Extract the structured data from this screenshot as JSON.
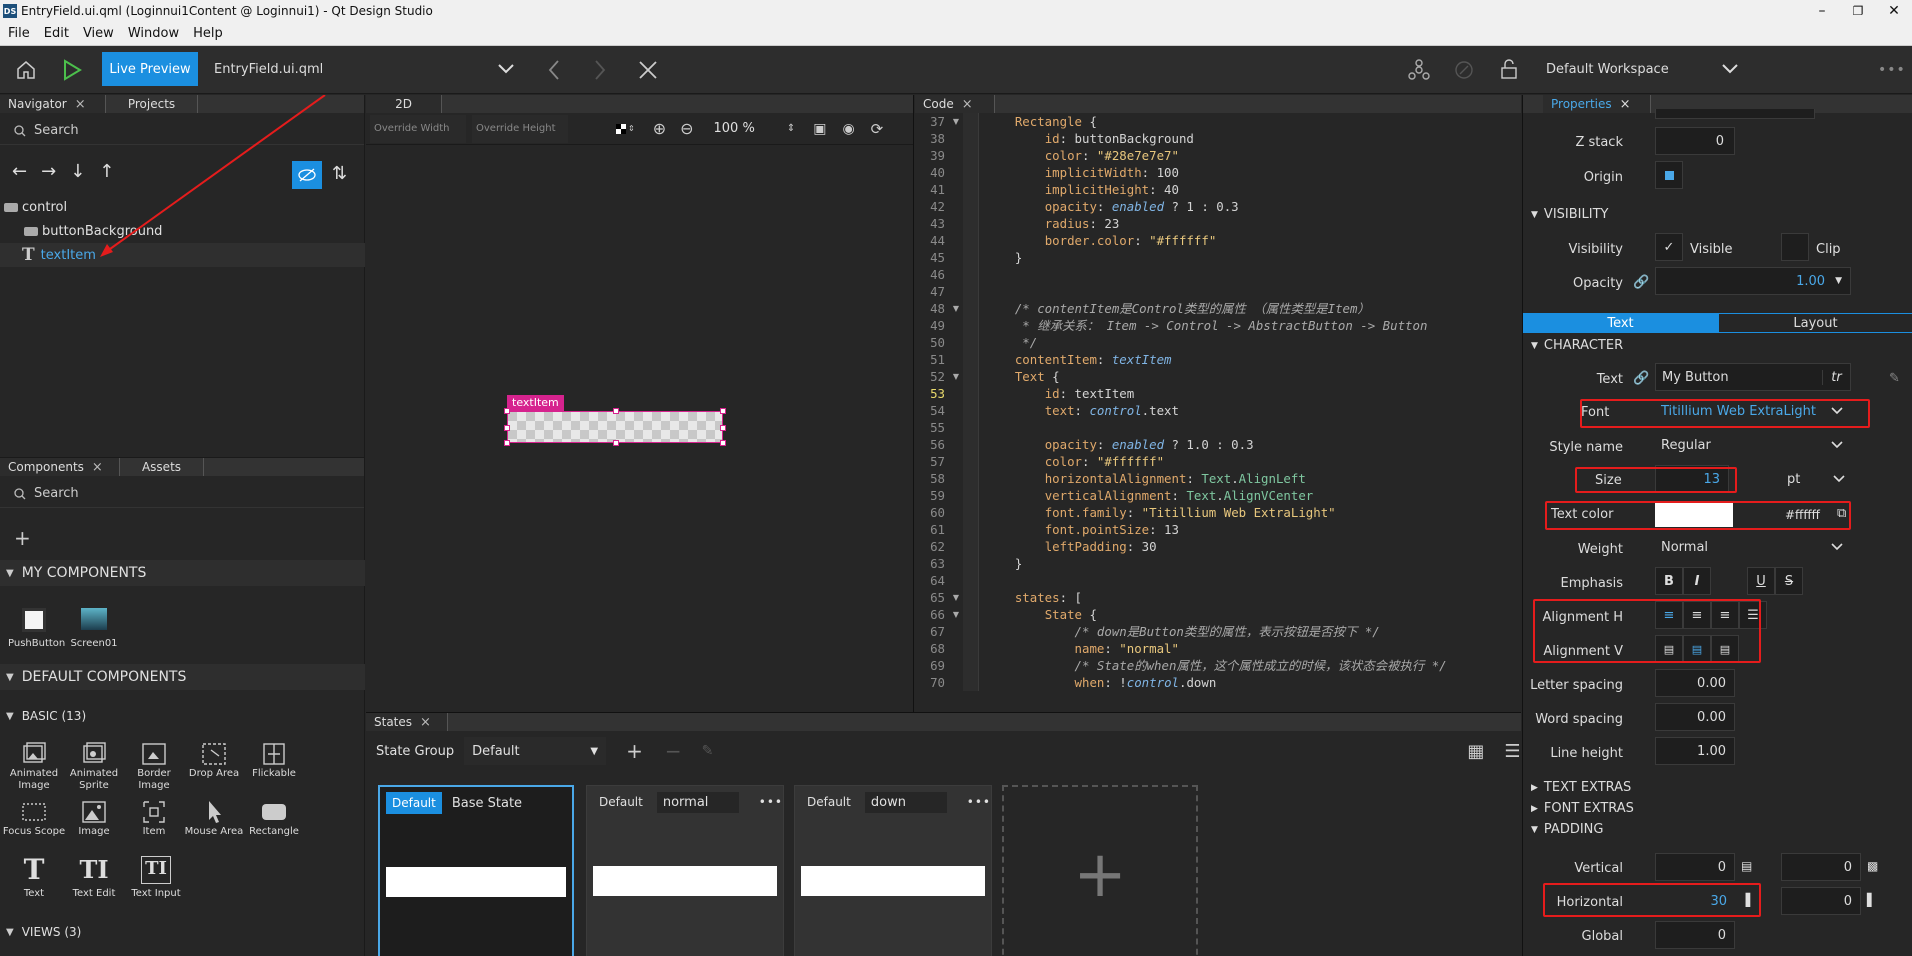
{
  "window": {
    "title": "EntryField.ui.qml (Loginnui1Content @ Loginnui1) - Qt Design Studio",
    "logo": "DS"
  },
  "menu": [
    "File",
    "Edit",
    "View",
    "Window",
    "Help"
  ],
  "toolbar": {
    "live_preview": "Live Preview",
    "file": "EntryField.ui.qml",
    "workspace": "Default Workspace"
  },
  "navigator": {
    "tabs": [
      "Navigator",
      "Projects"
    ],
    "search_placeholder": "Search",
    "tree": [
      {
        "label": "control",
        "icon": "rect-icon"
      },
      {
        "label": "buttonBackground",
        "icon": "rect-icon"
      },
      {
        "label": "textItem",
        "icon": "text-icon"
      }
    ]
  },
  "components": {
    "tabs": [
      "Components",
      "Assets"
    ],
    "search_placeholder": "Search",
    "my_header": "MY COMPONENTS",
    "my_items": [
      "PushButton",
      "Screen01"
    ],
    "default_header": "DEFAULT COMPONENTS",
    "basic_header": "BASIC (13)",
    "basic_items": [
      [
        "Animated",
        "Image"
      ],
      [
        "Animated",
        "Sprite"
      ],
      [
        "Border",
        "Image"
      ],
      [
        "Drop Area"
      ],
      [
        "Flickable"
      ],
      [
        "Focus Scope"
      ],
      [
        "Image"
      ],
      [
        "Item"
      ],
      [
        "Mouse Area"
      ],
      [
        "Rectangle"
      ],
      [
        "Text"
      ],
      [
        "Text Edit"
      ],
      [
        "Text Input"
      ]
    ],
    "views_header": "VIEWS (3)"
  },
  "canvas": {
    "tab": "2D",
    "override_width": "Override Width",
    "override_height": "Override Height",
    "zoom": "100 %",
    "selection_label": "textItem"
  },
  "code": {
    "tab": "Code",
    "lines": [
      {
        "n": "37",
        "t": "    Rectangle {"
      },
      {
        "n": "38",
        "t": "        id: buttonBackground"
      },
      {
        "n": "39",
        "t": "        color: \"#28e7e7e7\""
      },
      {
        "n": "40",
        "t": "        implicitWidth: 100"
      },
      {
        "n": "41",
        "t": "        implicitHeight: 40"
      },
      {
        "n": "42",
        "t": "        opacity: enabled ? 1 : 0.3"
      },
      {
        "n": "43",
        "t": "        radius: 23"
      },
      {
        "n": "44",
        "t": "        border.color: \"#ffffff\""
      },
      {
        "n": "45",
        "t": "    }"
      },
      {
        "n": "46",
        "t": ""
      },
      {
        "n": "47",
        "t": ""
      },
      {
        "n": "48",
        "t": "    /* contentItem是Control类型的属性 （属性类型是Item）"
      },
      {
        "n": "49",
        "t": "     * 继承关系： Item -> Control -> AbstractButton -> Button"
      },
      {
        "n": "50",
        "t": "     */"
      },
      {
        "n": "51",
        "t": "    contentItem: textItem"
      },
      {
        "n": "52",
        "t": "    Text {"
      },
      {
        "n": "53",
        "t": "        id: textItem"
      },
      {
        "n": "54",
        "t": "        text: control.text"
      },
      {
        "n": "55",
        "t": ""
      },
      {
        "n": "56",
        "t": "        opacity: enabled ? 1.0 : 0.3"
      },
      {
        "n": "57",
        "t": "        color: \"#ffffff\""
      },
      {
        "n": "58",
        "t": "        horizontalAlignment: Text.AlignLeft"
      },
      {
        "n": "59",
        "t": "        verticalAlignment: Text.AlignVCenter"
      },
      {
        "n": "60",
        "t": "        font.family: \"Titillium Web ExtraLight\""
      },
      {
        "n": "61",
        "t": "        font.pointSize: 13"
      },
      {
        "n": "62",
        "t": "        leftPadding: 30"
      },
      {
        "n": "63",
        "t": "    }"
      },
      {
        "n": "64",
        "t": ""
      },
      {
        "n": "65",
        "t": "    states: ["
      },
      {
        "n": "66",
        "t": "        State {"
      },
      {
        "n": "67",
        "t": "            /* down是Button类型的属性，表示按钮是否按下 */"
      },
      {
        "n": "68",
        "t": "            name: \"normal\""
      },
      {
        "n": "69",
        "t": "            /* State的when属性，这个属性成立的时候，该状态会被执行 */"
      },
      {
        "n": "70",
        "t": "            when: !control.down"
      }
    ]
  },
  "states": {
    "tab": "States",
    "group_label": "State Group",
    "group_value": "Default",
    "cards": [
      {
        "badge": "Default",
        "name": "Base State"
      },
      {
        "badge": "Default",
        "name": "normal"
      },
      {
        "badge": "Default",
        "name": "down"
      }
    ]
  },
  "properties": {
    "tab": "Properties",
    "z_stack_label": "Z stack",
    "z_stack_value": "0",
    "origin_label": "Origin",
    "visibility_header": "VISIBILITY",
    "visibility_label": "Visibility",
    "visible_label": "Visible",
    "clip_label": "Clip",
    "opacity_label": "Opacity",
    "opacity_value": "1.00",
    "subtabs": [
      "Text",
      "Layout"
    ],
    "character_header": "CHARACTER",
    "text_label": "Text",
    "text_value": "My Button",
    "tr_label": "tr",
    "font_label": "Font",
    "font_value": "Titillium Web ExtraLight",
    "style_label": "Style name",
    "style_value": "Regular",
    "size_label": "Size",
    "size_value": "13",
    "size_unit": "pt",
    "color_label": "Text color",
    "color_value": "#ffffff",
    "weight_label": "Weight",
    "weight_value": "Normal",
    "emphasis_label": "Emphasis",
    "emphasis_buttons": [
      "B",
      "I",
      "U",
      "S"
    ],
    "align_h_label": "Alignment H",
    "align_v_label": "Alignment V",
    "letter_label": "Letter spacing",
    "letter_value": "0.00",
    "word_label": "Word spacing",
    "word_value": "0.00",
    "line_label": "Line height",
    "line_value": "1.00",
    "text_extras": "TEXT EXTRAS",
    "font_extras": "FONT EXTRAS",
    "padding_header": "PADDING",
    "vertical_label": "Vertical",
    "vertical_value": "0",
    "vertical_value2": "0",
    "horizontal_label": "Horizontal",
    "horizontal_value": "30",
    "horizontal_value2": "0",
    "global_label": "Global",
    "global_value": "0"
  },
  "colors": {
    "accent": "#4aa8e8",
    "annotation": "#e51c1c",
    "selection": "#d6238e",
    "keyword": "#e0a96b",
    "string": "#e8c77d",
    "identifier": "#80b5e5",
    "comment": "#a9a9a9"
  }
}
